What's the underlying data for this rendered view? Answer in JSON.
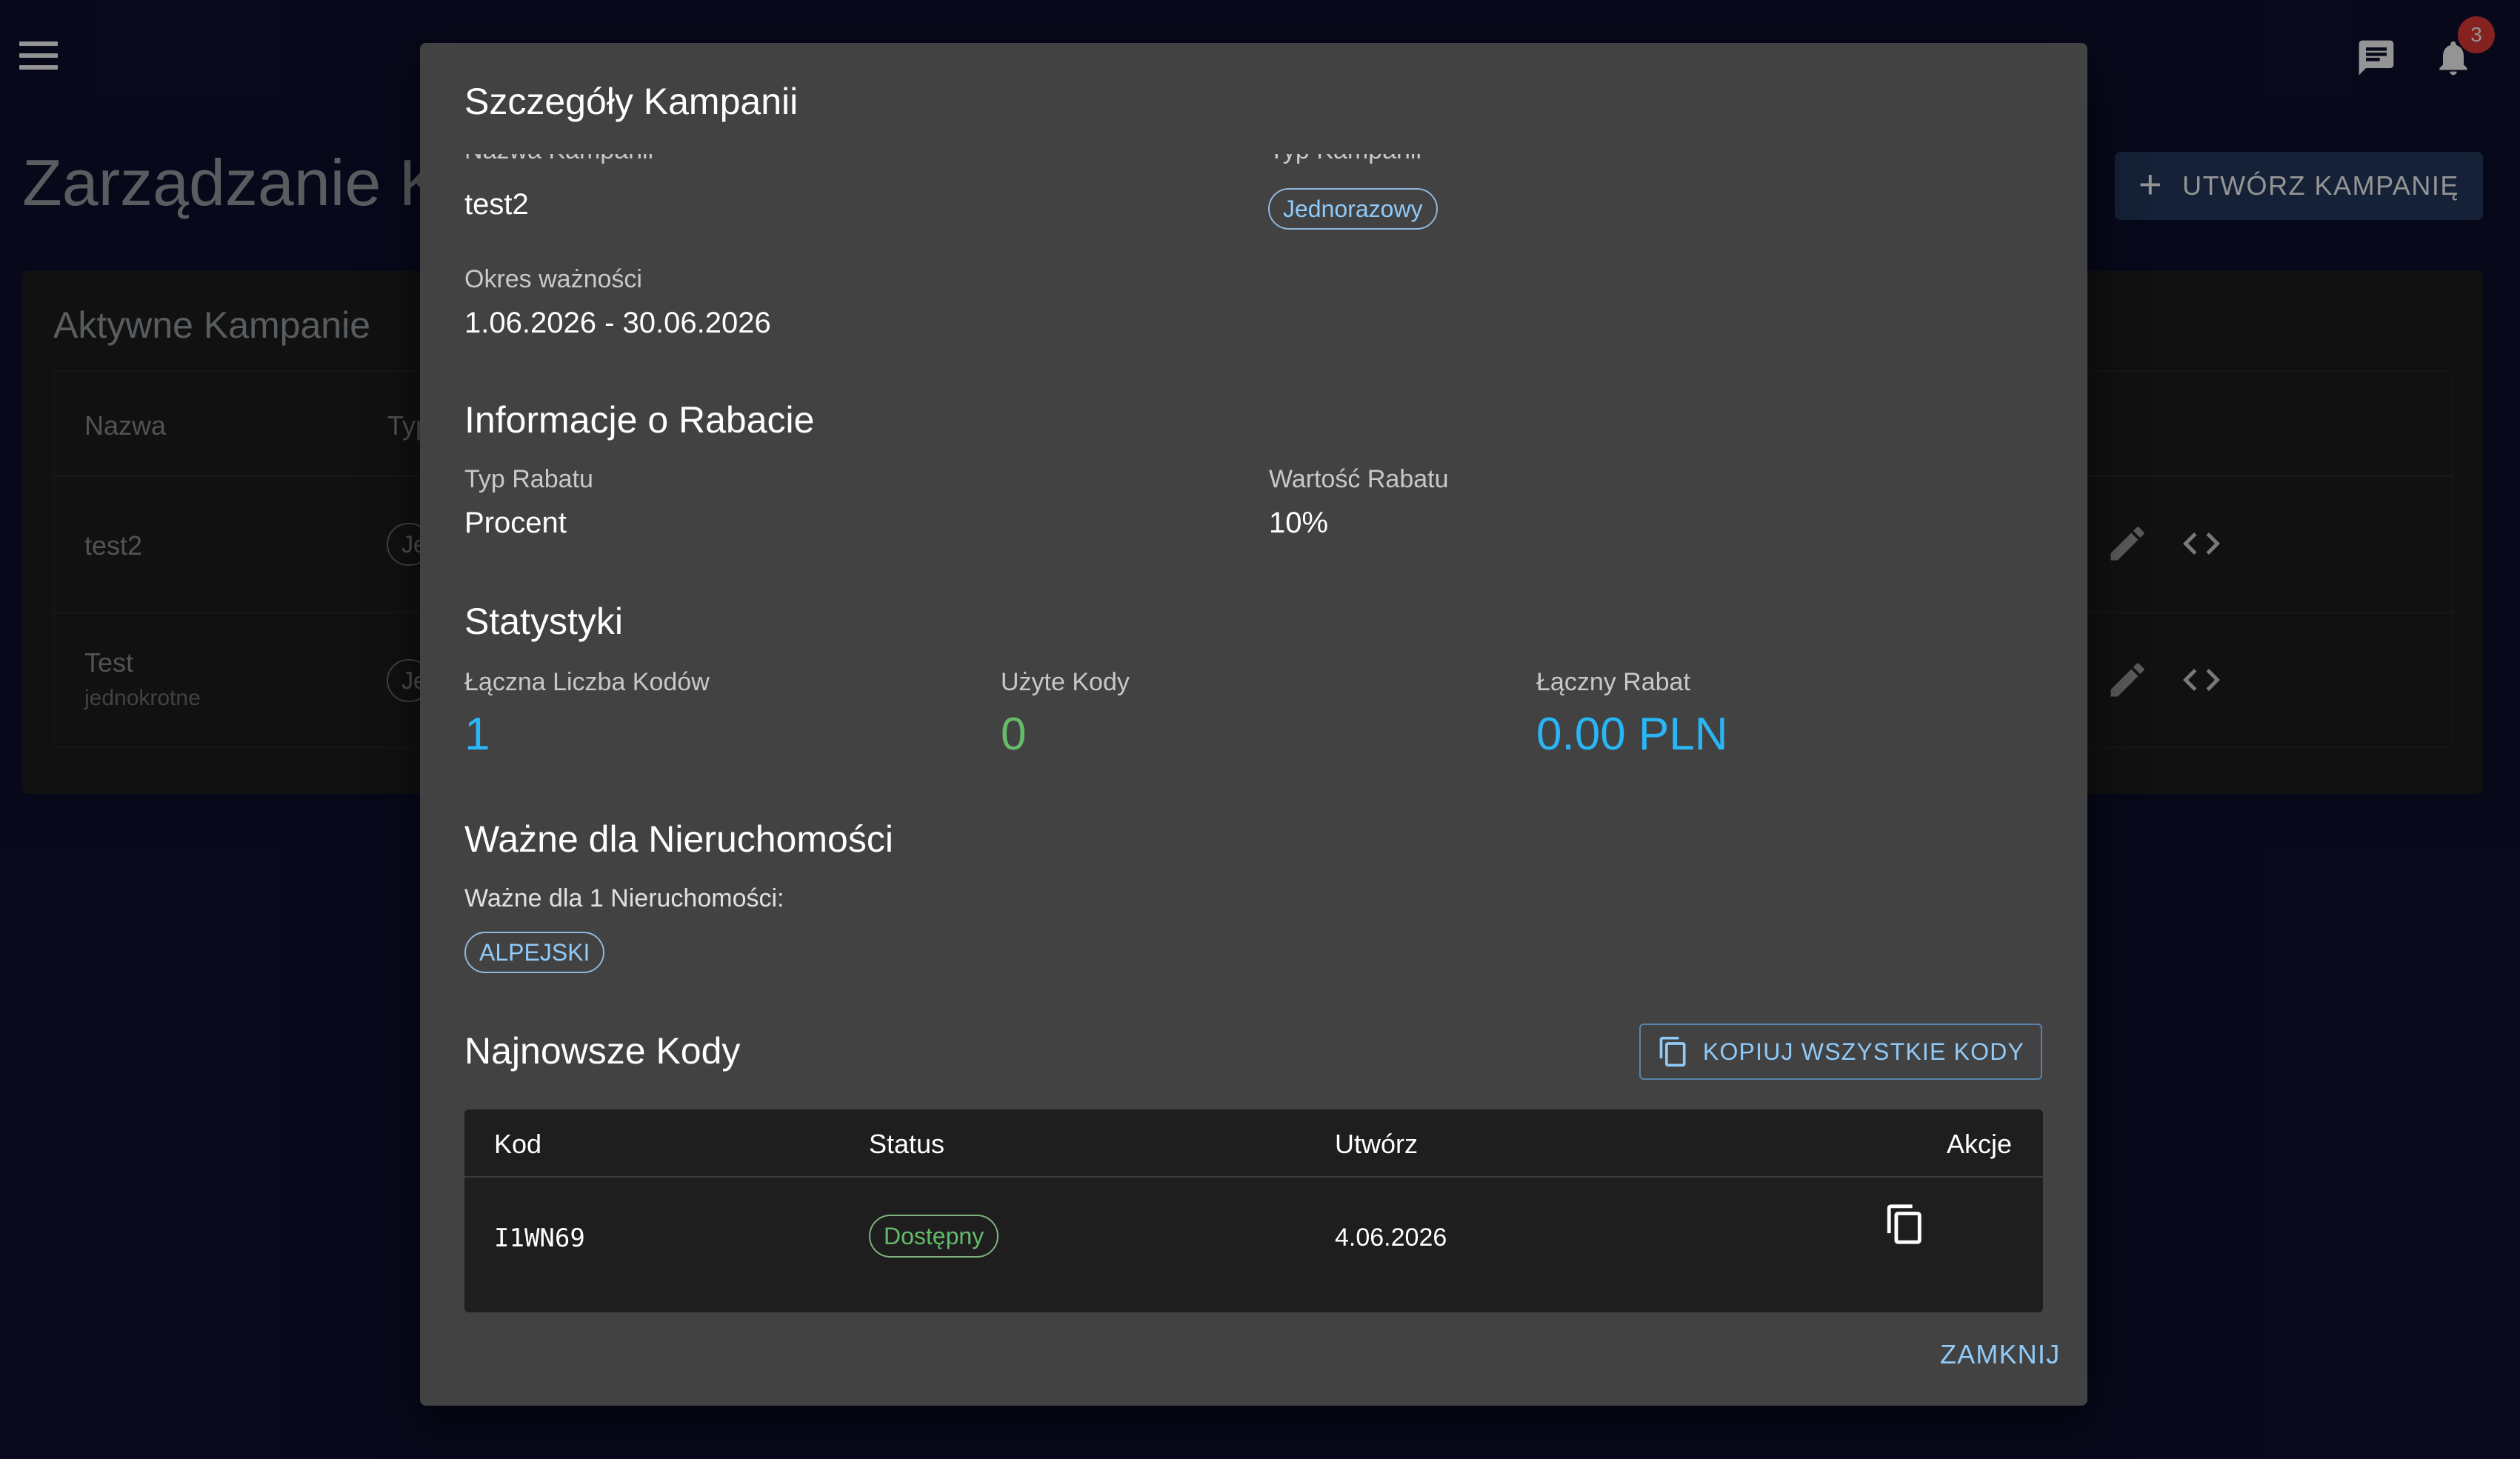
{
  "header": {
    "notification_count": "3"
  },
  "page": {
    "title": "Zarządzanie Kampaniami",
    "create_button": "UTWÓRZ KAMPANIĘ",
    "card_title": "Aktywne Kampanie",
    "table": {
      "columns": [
        "Nazwa",
        "Typ"
      ],
      "rows": [
        {
          "name": "test2",
          "sub": "",
          "type_chip": "Jednorazowy"
        },
        {
          "name": "Test",
          "sub": "jednokrotne",
          "type_chip": "Jednorazowy"
        }
      ]
    }
  },
  "dialog": {
    "title": "Szczegóły Kampanii",
    "campaign_name_label": "Nazwa Kampanii",
    "campaign_name": "test2",
    "campaign_type_label": "Typ Kampanii",
    "campaign_type": "Jednorazowy",
    "validity_label": "Okres ważności",
    "validity": "1.06.2026 - 30.06.2026",
    "discount_section": "Informacje o Rabacie",
    "discount_type_label": "Typ Rabatu",
    "discount_type": "Procent",
    "discount_value_label": "Wartość Rabatu",
    "discount_value": "10%",
    "stats_section": "Statystyki",
    "stats": {
      "total_codes_label": "Łączna Liczba Kodów",
      "total_codes": "1",
      "used_codes_label": "Użyte Kody",
      "used_codes": "0",
      "total_discount_label": "Łączny Rabat",
      "total_discount": "0.00 PLN"
    },
    "properties_section": "Ważne dla Nieruchomości",
    "properties_caption": "Ważne dla 1 Nieruchomości:",
    "properties": [
      "ALPEJSKI"
    ],
    "codes_section": "Najnowsze Kody",
    "copy_all_button": "KOPIUJ WSZYSTKIE KODY",
    "codes_table": {
      "columns": [
        "Kod",
        "Status",
        "Utwórz",
        "Akcje"
      ],
      "rows": [
        {
          "code": "I1WN69",
          "status": "Dostępny",
          "created": "4.06.2026"
        }
      ]
    },
    "close_button": "ZAMKNIJ"
  },
  "colors": {
    "background": "#0d1030",
    "dialog": "#424242",
    "accent_blue": "#90caf9",
    "stat_blue": "#29b6f6",
    "stat_green": "#66bb6a",
    "badge_red": "#e53935"
  }
}
